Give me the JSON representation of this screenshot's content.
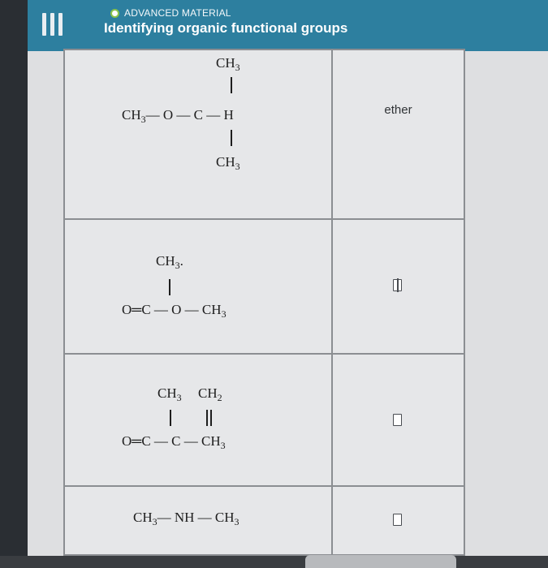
{
  "header": {
    "section_label": "ADVANCED MATERIAL",
    "title": "Identifying organic functional groups",
    "accent_color": "#2d7f9f",
    "status_color": "#8bc34a"
  },
  "rows": [
    {
      "structure": {
        "top": "CH",
        "top_sub": "3",
        "left": "CH",
        "left_sub": "3",
        "chain": "— O — C — H",
        "bottom": "CH",
        "bottom_sub": "3"
      },
      "answer": "ether"
    },
    {
      "structure": {
        "top": "CH",
        "top_sub": "3",
        "top_dot": ".",
        "chain": "O═C — O — CH",
        "chain_sub": "3"
      },
      "answer": ""
    },
    {
      "structure": {
        "top_a": "CH",
        "top_a_sub": "3",
        "top_b": "CH",
        "top_b_sub": "2",
        "chain": "O═C — C — CH",
        "chain_sub": "3"
      },
      "answer": ""
    },
    {
      "structure": {
        "chain": "CH",
        "chain_sub": "3",
        "chain_mid": "— NH — CH",
        "chain_end_sub": "3"
      },
      "answer": ""
    }
  ]
}
